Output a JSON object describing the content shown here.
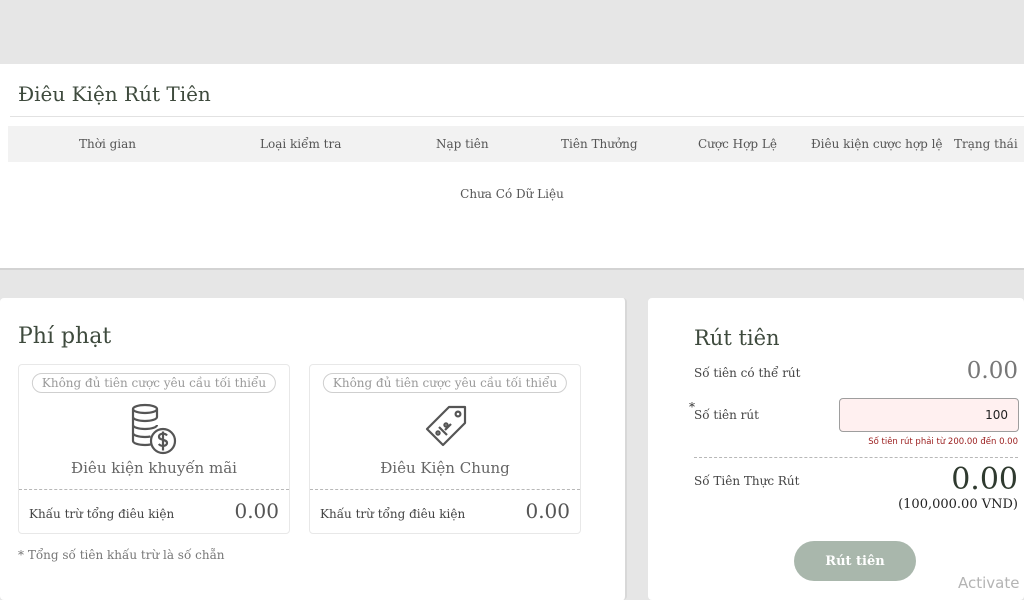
{
  "conditions": {
    "title": "Điêu Kiện Rút Tiên",
    "columns": [
      "Thời gian",
      "Loại kiểm tra",
      "Nạp tiên",
      "Tiên Thưởng",
      "Cược Hợp Lệ",
      "Điêu kiện cược hợp lệ",
      "Trạng thái"
    ],
    "empty_text": "Chưa Có Dữ Liệu"
  },
  "penalty": {
    "title": "Phí phạt",
    "cards": [
      {
        "badge": "Không đủ tiên cược yêu cầu tối thiểu",
        "icon": "coins-dollar-icon",
        "label": "Điêu kiện khuyến mãi",
        "deduct_label": "Khấu trừ tổng điêu kiện",
        "deduct_value": "0.00"
      },
      {
        "badge": "Không đủ tiên cược yêu cầu tối thiểu",
        "icon": "tag-percent-icon",
        "label": "Điêu Kiện Chung",
        "deduct_label": "Khấu trừ tổng điêu kiện",
        "deduct_value": "0.00"
      }
    ],
    "note": "* Tổng số tiên khấu trừ là số chẵn"
  },
  "withdraw": {
    "title": "Rút tiên",
    "available_label": "Số tiên có thể rút",
    "available_value": "0.00",
    "required_mark": "*",
    "amount_label": "Số tiên rút",
    "amount_value": "100",
    "error_text": "Số tiên rút phải từ 200.00 đến 0.00",
    "actual_label": "Số Tiên Thực Rút",
    "actual_value": "0.00",
    "actual_vnd": "(100,000.00 VND)",
    "button_label": "Rút tiên"
  },
  "watermark": "Activate",
  "colors": {
    "background": "#e6e6e6",
    "card": "#ffffff",
    "header_row": "#f2f2f2",
    "title_text": "#3e4a3d",
    "input_error_bg": "#fff0f0",
    "error_text": "#9a1c1c",
    "button": "#a9b7ac"
  }
}
